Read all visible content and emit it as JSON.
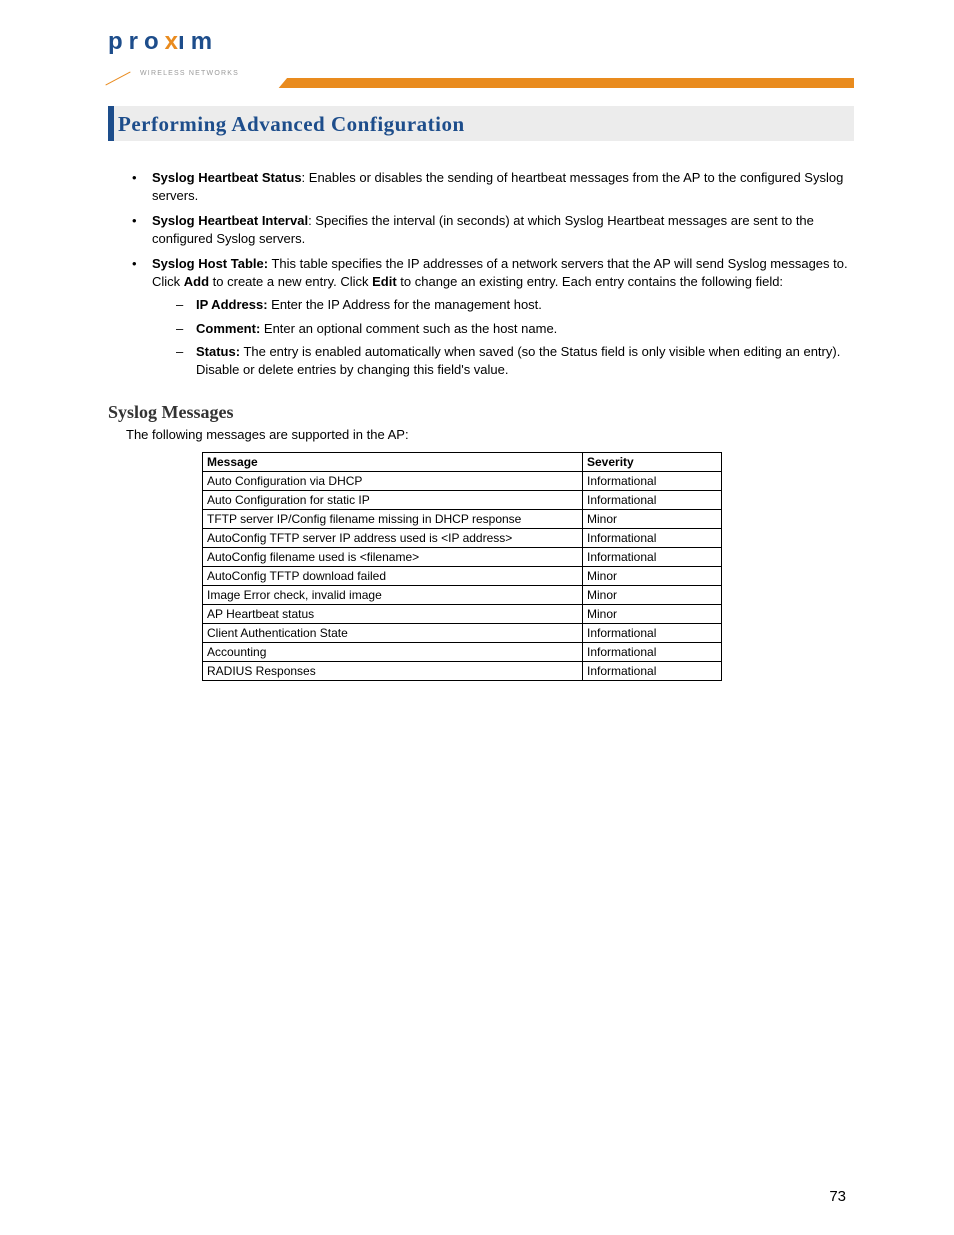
{
  "logo": {
    "brand_pre": "pro",
    "brand_x": "x",
    "brand_post": "ım",
    "tagline": "WIRELESS NETWORKS"
  },
  "title": "Performing Advanced Configuration",
  "bullets": [
    {
      "label": "Syslog Heartbeat Status",
      "sep": ":  ",
      "text": "Enables or disables the sending of heartbeat messages from the AP to the configured Syslog servers."
    },
    {
      "label": "Syslog Heartbeat Interval",
      "sep": ": ",
      "text": "Specifies the interval (in seconds) at which Syslog Heartbeat messages are sent to the configured Syslog servers."
    },
    {
      "label": "Syslog Host Table:",
      "sep": " ",
      "text_before": "This table specifies the IP addresses of a network servers that the AP will send Syslog messages to. Click ",
      "bold1": "Add",
      "text_mid": " to create a new entry. Click ",
      "bold2": "Edit",
      "text_after": " to change an existing entry. Each entry contains the following field:",
      "sub": [
        {
          "label": "IP Address:",
          "text": " Enter the IP Address for the management host."
        },
        {
          "label": "Comment:",
          "text": " Enter an optional comment such as the host name."
        },
        {
          "label": "Status:",
          "text": " The entry is enabled automatically when saved (so the Status field is only visible when editing an entry). Disable or delete entries by changing this field's value."
        }
      ]
    }
  ],
  "section_heading": "Syslog Messages",
  "section_intro": "The following messages are supported in the AP:",
  "table": {
    "headers": [
      "Message",
      "Severity"
    ],
    "rows": [
      [
        "Auto Configuration via DHCP",
        "Informational"
      ],
      [
        "Auto Configuration for static IP",
        "Informational"
      ],
      [
        "TFTP server IP/Config filename missing in DHCP response",
        "Minor"
      ],
      [
        "AutoConfig TFTP server IP address used is <IP address>",
        "Informational"
      ],
      [
        "AutoConfig filename used is <filename>",
        "Informational"
      ],
      [
        "AutoConfig TFTP download failed",
        "Minor"
      ],
      [
        "Image Error check, invalid image",
        "Minor"
      ],
      [
        "AP Heartbeat status",
        "Minor"
      ],
      [
        "Client Authentication State",
        "Informational"
      ],
      [
        "Accounting",
        "Informational"
      ],
      [
        "RADIUS Responses",
        "Informational"
      ]
    ]
  },
  "page_number": "73"
}
